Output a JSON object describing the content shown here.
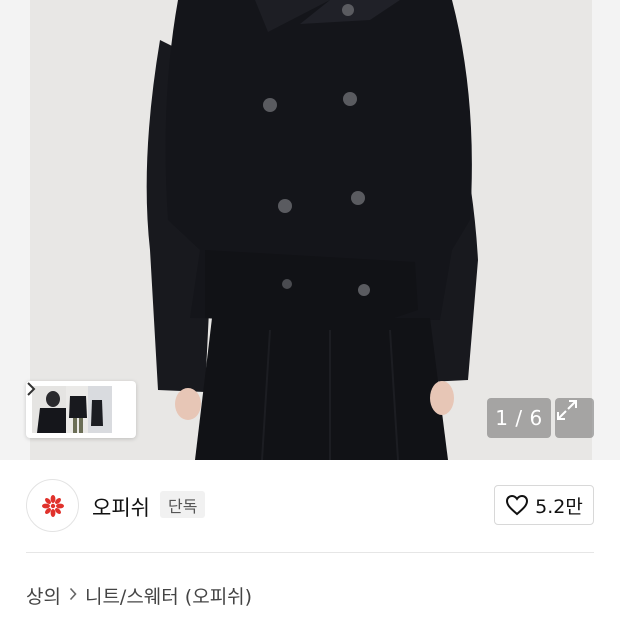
{
  "gallery": {
    "counter_text": "1 / 6",
    "current_index": 1,
    "total": 6,
    "thumbnail_more_icon": "chevron-right-icon",
    "expand_icon": "expand-icon"
  },
  "brand": {
    "name": "오피쉬",
    "tag": "단독",
    "logo_icon": "red-flower-logo"
  },
  "like": {
    "count": "5.2만",
    "icon": "heart-icon"
  },
  "breadcrumb": {
    "items": [
      "상의",
      "니트/스웨터 (오피쉬)"
    ],
    "separator_icon": "chevron-right-icon"
  },
  "colors": {
    "photo_background": "#e9e8e6",
    "garment": "#15161b",
    "logo_red": "#e0322c",
    "overlay": "rgba(110,110,110,0.55)"
  }
}
